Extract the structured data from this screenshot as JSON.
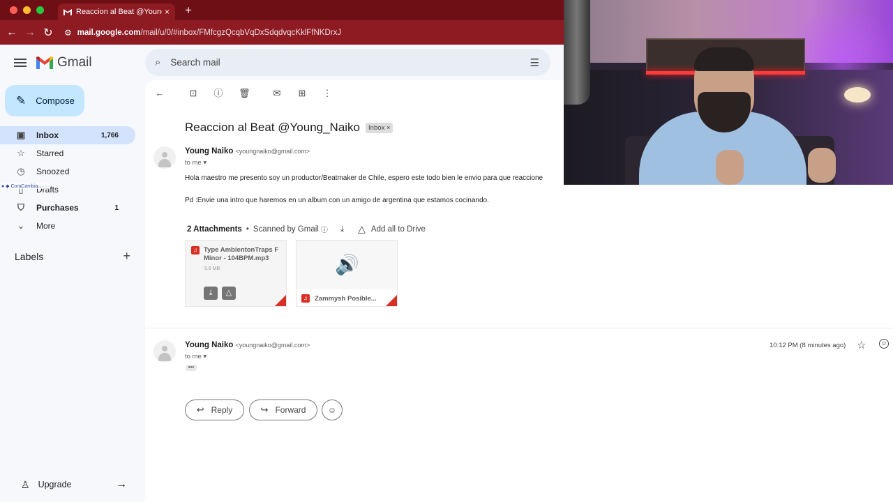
{
  "browser": {
    "tab_title": "Reaccion al Beat @Young_Naiko",
    "tab_close": "×",
    "new_tab": "+",
    "url_host": "mail.google.com",
    "url_path": "/mail/u/0/#inbox/FMfcgzQcqbVqDxSdqdvqcKklFfNKDrxJ",
    "colors": {
      "tabbar": "#6e0f15",
      "urlbar": "#8e1a22"
    }
  },
  "gmail": {
    "brand": "Gmail",
    "compose_label": "Compose",
    "search_placeholder": "Search mail",
    "nav": [
      {
        "icon": "inbox-icon",
        "label": "Inbox",
        "count": "1,766",
        "active": true
      },
      {
        "icon": "star-icon",
        "label": "Starred",
        "count": ""
      },
      {
        "icon": "clock-icon",
        "label": "Snoozed",
        "count": ""
      },
      {
        "icon": "file-icon",
        "label": "Drafts",
        "count": ""
      },
      {
        "icon": "tag-icon",
        "label": "Purchases",
        "count": "1",
        "bold": true
      },
      {
        "icon": "chevron-down-icon",
        "label": "More",
        "count": ""
      }
    ],
    "overlay_text": "● ◆ ComCambia · · · ·",
    "labels_heading": "Labels",
    "upgrade_label": "Upgrade"
  },
  "email": {
    "subject": "Reaccion al Beat @Young_Naiko",
    "label_badge": "Inbox ×",
    "messages": [
      {
        "sender_name": "Young Naiko",
        "sender_email": "<youngnaiko@gmail.com>",
        "to": "to me ▾",
        "body_1": "Hola maestro me presento soy un productor/Beatmaker de Chile, espero este todo bien le envio para que reaccione",
        "body_2": "Pd :Envie una intro que haremos en un album con un amigo de argentina que estamos cocinando."
      },
      {
        "sender_name": "Young Naiko",
        "sender_email": "<youngnaiko@gmail.com>",
        "to": "to me ▾",
        "timestamp": "10:12 PM (8 minutes ago)",
        "collapsed": "•••"
      }
    ],
    "attachments_count": "2 Attachments",
    "scanned_label": "Scanned by Gmail",
    "add_to_drive": "Add all to Drive",
    "attachments": [
      {
        "name": "Type AmbientonTraps F Minor - 104BPM.mp3",
        "size": "5.6 MB"
      },
      {
        "name": "Zammysh Posible..."
      }
    ],
    "reply_label": "Reply",
    "forward_label": "Forward"
  }
}
